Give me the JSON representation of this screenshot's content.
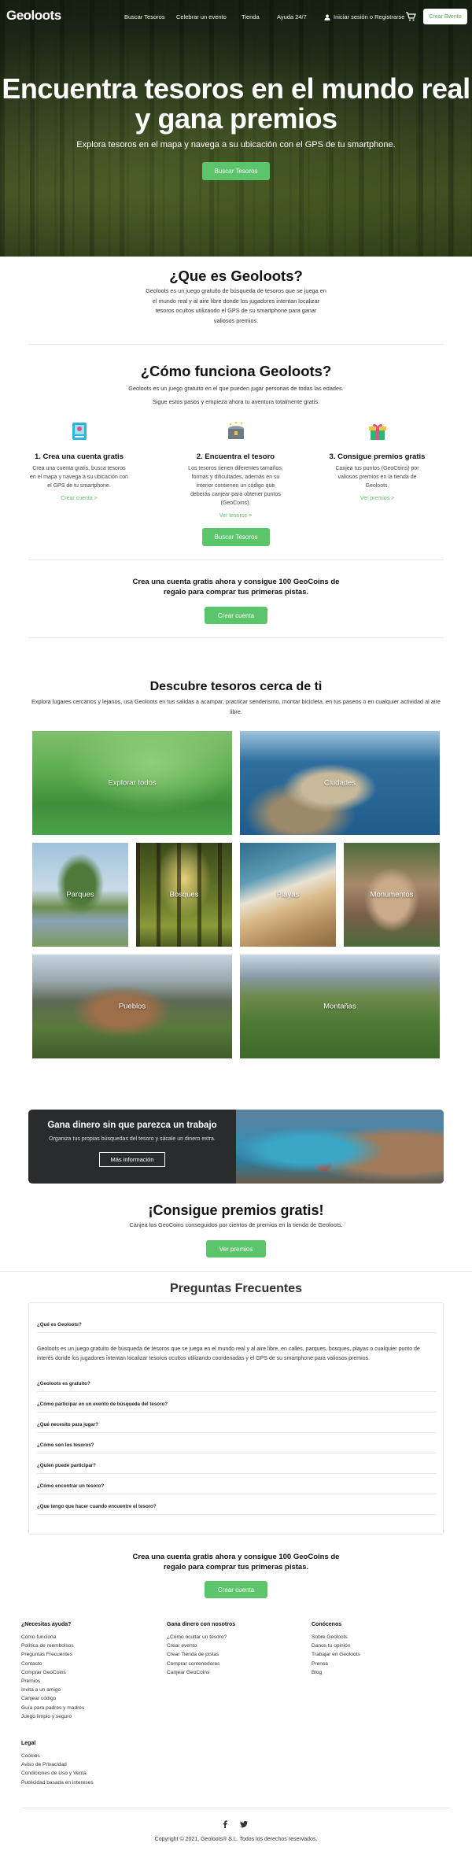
{
  "nav": {
    "logo": "Geoloots",
    "items": [
      "Buscar Tesoros",
      "Celebrar un evento",
      "Tienda",
      "Ayuda 24/7"
    ],
    "login": "Iniciar sesión o Registrarse",
    "cta": "Crear Evento"
  },
  "hero": {
    "title": "Encuentra tesoros en el mundo real y gana premios",
    "subtitle": "Explora tesoros en el mapa y navega a su ubicación con el GPS de tu smartphone.",
    "button": "Buscar Tesoros"
  },
  "what": {
    "title": "¿Que es Geoloots?",
    "text": "Geoloots es un juego gratuito de búsqueda de tesoros que se juega en el mundo real y al aire libre donde los jugadores intentan localizar tesoros ocultos utilizando el GPS de su smartphone para ganar valiosos premios."
  },
  "how": {
    "title": "¿Cómo funciona Geoloots?",
    "text1": "Geoloots es un juego gratuito en el que pueden jugar personas de todas las edades.",
    "text2": "Sigue estos pasos y empieza ahora tu aventura totalmente gratis.",
    "steps": [
      {
        "title": "1. Crea una cuenta gratis",
        "desc": "Crea una cuenta gratis, busca tesoros en el mapa y navega a su ubicación con el GPS de tu smartphone.",
        "link": "Crear cuenta >"
      },
      {
        "title": "2. Encuentra el tesoro",
        "desc": "Los tesoros tienen diferentes tamaños, formas y dificultades, además en su interior contienen un código que deberás canjear para obtener puntos (GeoCoins).",
        "link": "Ver tesoros >"
      },
      {
        "title": "3. Consigue premios gratis",
        "desc": "Canjea tus puntos (GeoCoins) por valiosos premios en la tienda de Geoloots.",
        "link": "Ver premios >"
      }
    ],
    "button": "Buscar Tesoros"
  },
  "signup": {
    "text": "Crea una cuenta gratis ahora y consigue 100 GeoCoins de regalo para comprar tus primeras pistas.",
    "button": "Crear cuenta"
  },
  "discover": {
    "title": "Descubre tesoros cerca de ti",
    "text": "Explora lugares cercanos y lejanos, usa Geoloots en tus salidas a acampar, practicar senderismo, montar bicicleta, en tus paseos o en cualquier actividad al aire libre.",
    "tiles": [
      "Explorar todos",
      "Ciudades",
      "Parques",
      "Bosques",
      "Playas",
      "Monumentos",
      "Pueblos",
      "Montañas"
    ]
  },
  "earn": {
    "title": "Gana dinero sin que parezca un trabajo",
    "text": "Organiza tus propias búsquedas del tesoro y sácale un dinero extra.",
    "button": "Más información"
  },
  "prizes": {
    "title": "¡Consigue premios gratis!",
    "text": "Canjea los GeoCoins conseguidos por cientos de premios en la tienda de Geoloots.",
    "button": "Ver premios"
  },
  "faq": {
    "title": "Preguntas Frecuentes",
    "q1": "¿Qué es Geoloots?",
    "a1": "Geoloots es un juego gratuito de búsqueda de tesoros que se juega en el mundo real y al aire libre, en calles, parques, bosques, playas o cualquier punto de interés donde los jugadores intentan localizar tesoros ocultos utilizando coordenadas y el GPS de su smartphone para valiosos premios.",
    "questions": [
      "¿Geoloots es gratuito?",
      "¿Cómo participar en un evento de búsqueda del tesoro?",
      "¿Qué necesito para jugar?",
      "¿Cómo son los tesoros?",
      "¿Quien puede participar?",
      "¿Cómo encontrar un tesoro?",
      "¿Que tengo que hacer cuando encuentre el tesoro?"
    ]
  },
  "signup2": {
    "text": "Crea una cuenta gratis ahora y consigue 100 GeoCoins de regalo para comprar tus primeras pistas.",
    "button": "Crear cuenta"
  },
  "footer": {
    "col1": {
      "title": "¿Necesitas ayuda?",
      "links": [
        "Cómo funciona",
        "Política de reembolsos",
        "Preguntas Frecuentes",
        "Contacto",
        "Comprar GeoCoins",
        "Premios",
        "Invita a un amigo",
        "Canjear código",
        "Guía para padres y madres",
        "Juego limpio y seguro"
      ]
    },
    "col2": {
      "title": "Gana dinero con nosotros",
      "links": [
        "¿Cómo ocultar un tesoro?",
        "Crear evento",
        "Crear Tienda de pistas",
        "Comprar contenedores",
        "Canjear GeoCoins"
      ]
    },
    "col3": {
      "title": "Conócenos",
      "links": [
        "Sobre Geoloots",
        "Danos tu opinión",
        "Trabajar en Geoloots",
        "Prensa",
        "Blog"
      ]
    },
    "legal": {
      "title": "Legal",
      "links": [
        "Cookies",
        "Aviso de Privacidad",
        "Condiciones de Uso y Venta",
        "Publicidad basada en intereses"
      ]
    },
    "social": [
      "facebook-icon",
      "twitter-icon"
    ],
    "copyright": "Copyright © 2021, Geoloots® S.L. Todos los derechos reservados."
  },
  "colors": {
    "accent": "#5cc46a",
    "dark": "#2a2b2d"
  }
}
